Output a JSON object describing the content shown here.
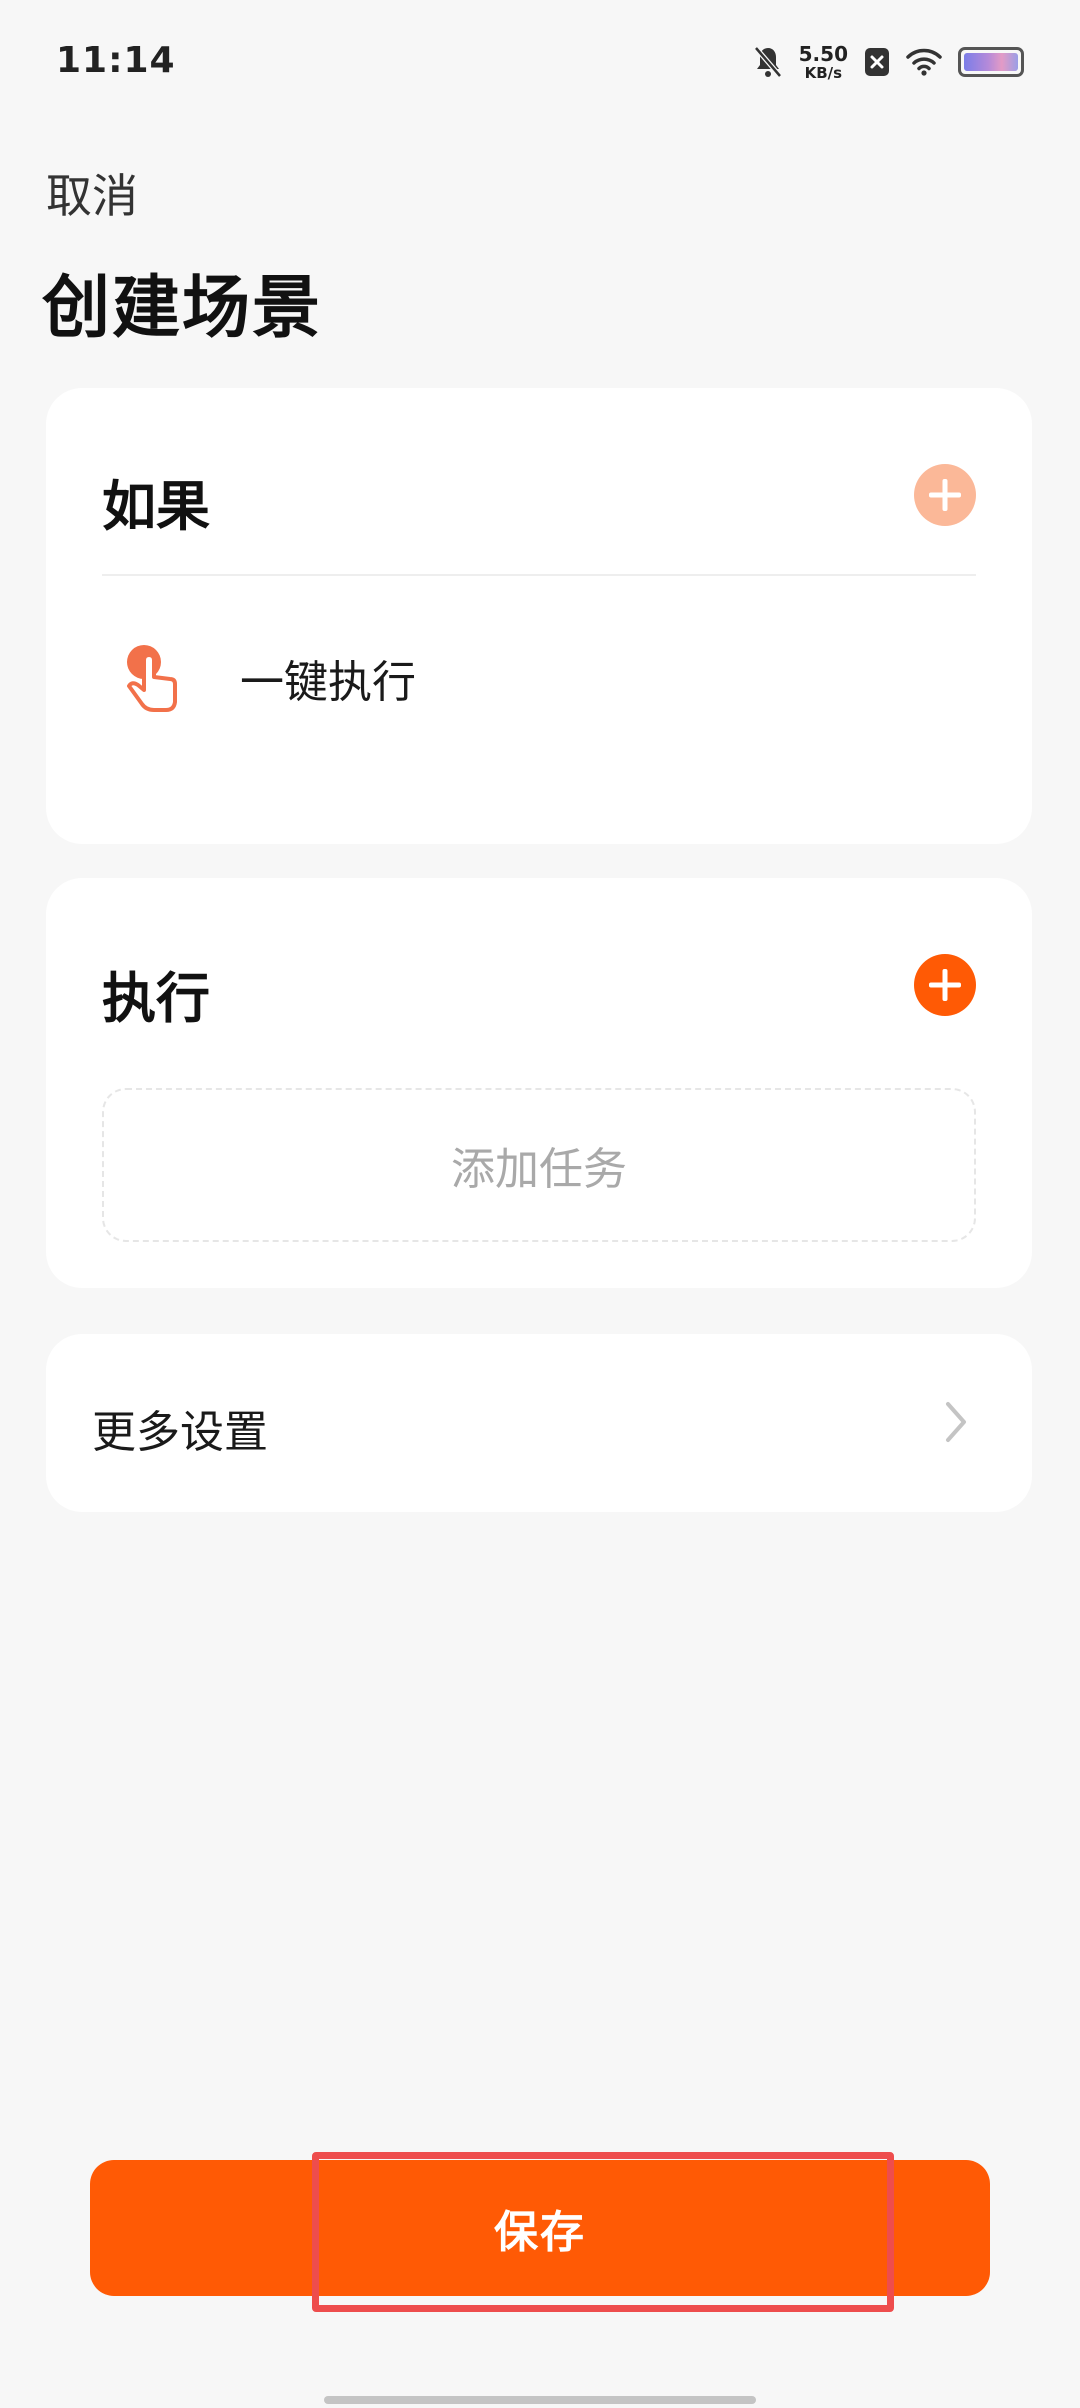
{
  "status_bar": {
    "time": "11:14",
    "net_speed_value": "5.50",
    "net_speed_unit": "KB/s",
    "icons": [
      "bell-muted-icon",
      "close-box-icon",
      "wifi-icon",
      "battery-icon"
    ]
  },
  "header": {
    "cancel_label": "取消",
    "title": "创建场景"
  },
  "if_section": {
    "title": "如果",
    "add_icon": "plus-icon",
    "trigger": {
      "icon": "tap-hand-icon",
      "label": "一键执行"
    }
  },
  "do_section": {
    "title": "执行",
    "add_icon": "plus-icon",
    "placeholder": "添加任务"
  },
  "more_settings": {
    "label": "更多设置",
    "icon": "chevron-right-icon"
  },
  "save_button": {
    "label": "保存"
  },
  "colors": {
    "accent": "#ff5a05",
    "accent_light": "#fbb898",
    "background": "#f7f7f7",
    "card": "#ffffff",
    "highlight": "#ee4d4d"
  }
}
